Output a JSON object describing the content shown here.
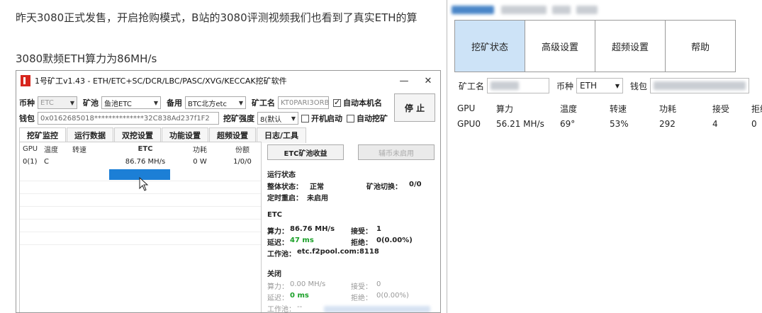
{
  "article": {
    "line1": "昨天3080正式发售，开启抢购模式，B站的3080评测视频我们也看到了真实ETH的算",
    "line2": "3080默频ETH算力为86MH/s"
  },
  "miner_a": {
    "title": "1号矿工v1.43 - ETH/ETC+SC/DCR/LBC/PASC/XVG/KECCAK挖矿软件",
    "minimize": "—",
    "close": "✕",
    "coin_label": "币种",
    "coin_value": "ETC",
    "pool_label": "矿池",
    "pool_value": "鱼池ETC",
    "backup_label": "备用",
    "backup_value": "BTC北方etc",
    "worker_label": "矿工名",
    "worker_value": "KT0PARI3ORB",
    "auto_name_label": "自动本机名",
    "stop_label": "停 止",
    "wallet_label": "钱包",
    "wallet_value": "0x0162685018**************32C838Ad237f1F2",
    "intensity_label": "挖矿强度",
    "intensity_value": "8(默认",
    "boot_label": "开机启动",
    "auto_mine_label": "自动挖矿",
    "tabs": [
      "挖矿监控",
      "运行数据",
      "双挖设置",
      "功能设置",
      "超频设置",
      "日志/工具"
    ],
    "grid": {
      "headers": [
        "GPU",
        "温度",
        "转速",
        "ETC",
        "功耗",
        "份额"
      ],
      "row": [
        "0(1)",
        "C",
        "",
        "86.76 MH/s",
        "0 W",
        "1/0/0"
      ]
    },
    "panel": {
      "income_btn": "ETC矿池收益",
      "dual_btn": "辅币未启用",
      "run_status": "运行状态",
      "overall_label": "整体状态：",
      "overall_value": "正常",
      "pool_switch_label": "矿池切换：",
      "pool_switch_value": "0/0",
      "timer_label": "定时重启：",
      "timer_value": "未启用",
      "etc_section": "ETC",
      "hash_label": "算力：",
      "hash_value": "86.76 MH/s",
      "accept_label": "接受：",
      "accept_value": "1",
      "latency_label": "延迟：",
      "latency_value": "47 ms",
      "reject_label": "拒绝：",
      "reject_value": "0(0.00%)",
      "workpool_label": "工作池：",
      "workpool_value": "etc.f2pool.com:8118",
      "closed_section": "关闭",
      "hash2_label": "算力：",
      "hash2_value": "0.00 MH/s",
      "accept2_label": "接受：",
      "accept2_value": "0",
      "latency2_label": "延迟：",
      "latency2_value": "0 ms",
      "reject2_label": "拒绝：",
      "reject2_value": "0(0.00%)",
      "workpool2_label": "工作池：",
      "workpool2_value": "--"
    }
  },
  "miner_b": {
    "tabs": [
      "挖矿状态",
      "高级设置",
      "超频设置",
      "帮助"
    ],
    "worker_label": "矿工名",
    "coin_label": "币种",
    "coin_value": "ETH",
    "wallet_label": "钱包",
    "headers": [
      "GPU",
      "算力",
      "温度",
      "转速",
      "功耗",
      "接受",
      "拒绝"
    ],
    "row": [
      "GPU0",
      "56.21 MH/s",
      "69°",
      "53%",
      "292",
      "4",
      "0"
    ]
  },
  "colors": {
    "tab_active_bg": "#cde3f7",
    "selection_blue": "#1c7fd6",
    "latency_green": "#1aa028",
    "logo_red": "#d7261e"
  }
}
